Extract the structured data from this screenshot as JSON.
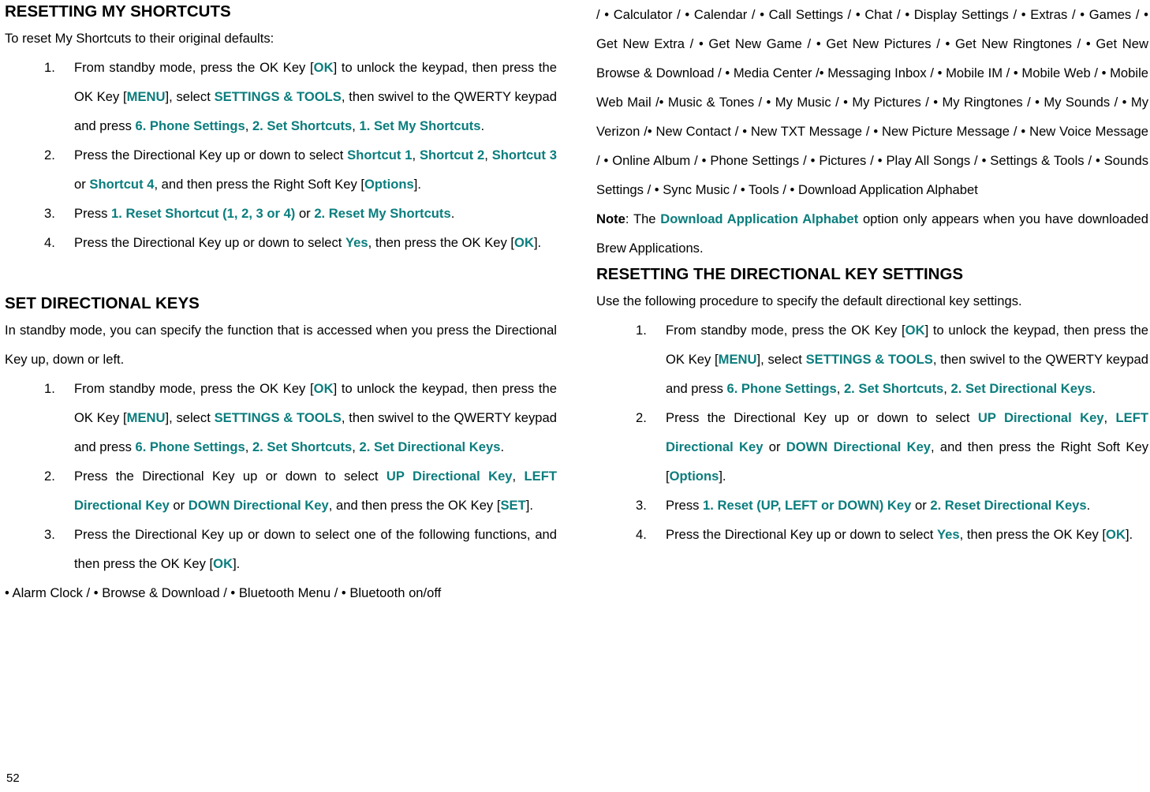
{
  "page": {
    "number": "52",
    "accent_color": "#0b7d7d",
    "text_color": "#000000",
    "background_color": "#ffffff"
  },
  "left_column": {
    "section1": {
      "heading": "RESETTING MY SHORTCUTS",
      "intro": "To reset My Shortcuts to their original defaults:",
      "steps": [
        {
          "number": "1.",
          "parts": [
            {
              "text": "From standby mode, press the OK Key [",
              "style": "plain"
            },
            {
              "text": "OK",
              "style": "accent"
            },
            {
              "text": "] to unlock the keypad, then press the OK Key [",
              "style": "plain"
            },
            {
              "text": "MENU",
              "style": "accent"
            },
            {
              "text": "], select ",
              "style": "plain"
            },
            {
              "text": "SETTINGS & TOOLS",
              "style": "accent"
            },
            {
              "text": ", then swivel to the QWERTY keypad and press ",
              "style": "plain"
            },
            {
              "text": "6. Phone Settings",
              "style": "accent"
            },
            {
              "text": ", ",
              "style": "plain"
            },
            {
              "text": "2. Set Shortcuts",
              "style": "accent"
            },
            {
              "text": ", ",
              "style": "plain"
            },
            {
              "text": "1. Set My Shortcuts",
              "style": "accent"
            },
            {
              "text": ".",
              "style": "plain"
            }
          ]
        },
        {
          "number": "2.",
          "parts": [
            {
              "text": "Press the Directional Key up or down to select ",
              "style": "plain"
            },
            {
              "text": "Shortcut 1",
              "style": "accent"
            },
            {
              "text": ", ",
              "style": "plain"
            },
            {
              "text": "Shortcut 2",
              "style": "accent"
            },
            {
              "text": ", ",
              "style": "plain"
            },
            {
              "text": "Shortcut 3",
              "style": "accent"
            },
            {
              "text": " or ",
              "style": "plain"
            },
            {
              "text": "Shortcut 4",
              "style": "accent"
            },
            {
              "text": ", and then press the Right Soft Key [",
              "style": "plain"
            },
            {
              "text": "Options",
              "style": "accent"
            },
            {
              "text": "].",
              "style": "plain"
            }
          ]
        },
        {
          "number": "3.",
          "parts": [
            {
              "text": "Press ",
              "style": "plain"
            },
            {
              "text": "1. Reset Shortcut (1, 2, 3 or 4)",
              "style": "accent"
            },
            {
              "text": " or ",
              "style": "plain"
            },
            {
              "text": "2. Reset My Shortcuts",
              "style": "accent"
            },
            {
              "text": ".",
              "style": "plain"
            }
          ]
        },
        {
          "number": "4.",
          "parts": [
            {
              "text": "Press the Directional Key up or down to select ",
              "style": "plain"
            },
            {
              "text": "Yes",
              "style": "accent"
            },
            {
              "text": ", then press the OK Key [",
              "style": "plain"
            },
            {
              "text": "OK",
              "style": "accent"
            },
            {
              "text": "].",
              "style": "plain"
            }
          ]
        }
      ]
    },
    "section2": {
      "heading": "SET DIRECTIONAL KEYS",
      "intro": "In standby mode, you can specify the function that is accessed when you press the Directional Key up, down or left.",
      "steps": [
        {
          "number": "1.",
          "parts": [
            {
              "text": "From standby mode, press the OK Key [",
              "style": "plain"
            },
            {
              "text": "OK",
              "style": "accent"
            },
            {
              "text": "] to unlock the keypad, then press the OK Key [",
              "style": "plain"
            },
            {
              "text": "MENU",
              "style": "accent"
            },
            {
              "text": "], select ",
              "style": "plain"
            },
            {
              "text": "SETTINGS & TOOLS",
              "style": "accent"
            },
            {
              "text": ", then swivel to the QWERTY keypad and press ",
              "style": "plain"
            },
            {
              "text": "6. Phone Settings",
              "style": "accent"
            },
            {
              "text": ", ",
              "style": "plain"
            },
            {
              "text": "2. Set Shortcuts",
              "style": "accent"
            },
            {
              "text": ", ",
              "style": "plain"
            },
            {
              "text": "2. Set Directional Keys",
              "style": "accent"
            },
            {
              "text": ".",
              "style": "plain"
            }
          ]
        },
        {
          "number": "2.",
          "parts": [
            {
              "text": "Press the Directional Key up or down to select ",
              "style": "plain"
            },
            {
              "text": "UP Directional Key",
              "style": "accent"
            },
            {
              "text": ", ",
              "style": "plain"
            },
            {
              "text": "LEFT Directional Key",
              "style": "accent"
            },
            {
              "text": " or ",
              "style": "plain"
            },
            {
              "text": "DOWN Directional Key",
              "style": "accent"
            },
            {
              "text": ", and then press the OK Key [",
              "style": "plain"
            },
            {
              "text": "SET",
              "style": "accent"
            },
            {
              "text": "].",
              "style": "plain"
            }
          ]
        },
        {
          "number": "3.",
          "parts": [
            {
              "text": "Press the Directional Key up or down to select one of the following functions, and then press the OK Key [",
              "style": "plain"
            },
            {
              "text": "OK",
              "style": "accent"
            },
            {
              "text": "].",
              "style": "plain"
            }
          ]
        }
      ],
      "function_list_part1": "• Alarm Clock / • Browse & Download / • Bluetooth Menu / • Bluetooth on/off"
    }
  },
  "right_column": {
    "function_list_part2": "/ • Calculator / • Calendar / • Call Settings / • Chat / • Display Settings / • Extras / • Games / • Get New Extra / • Get New Game / • Get New Pictures / • Get New Ringtones / • Get New Browse & Download / • Media Center /• Messaging Inbox / • Mobile IM / • Mobile Web / • Mobile Web Mail /• Music & Tones / • My Music / • My Pictures / • My Ringtones / • My Sounds / • My Verizon /• New Contact / • New TXT Message / • New Picture Message / • New Voice Message / • Online Album / • Phone Settings / • Pictures / • Play All Songs / • Settings & Tools / • Sounds Settings / • Sync Music / • Tools / • Download Application Alphabet",
    "note": {
      "label": "Note",
      "parts": [
        {
          "text": "Note",
          "style": "bold"
        },
        {
          "text": ": The ",
          "style": "plain"
        },
        {
          "text": "Download Application Alphabet",
          "style": "accent"
        },
        {
          "text": " option only appears when you have downloaded Brew Applications.",
          "style": "plain"
        }
      ]
    },
    "section3": {
      "heading": "RESETTING THE DIRECTIONAL KEY SETTINGS",
      "intro": "Use the following procedure to specify the default directional key settings.",
      "steps": [
        {
          "number": "1.",
          "parts": [
            {
              "text": "From standby mode, press the OK Key [",
              "style": "plain"
            },
            {
              "text": "OK",
              "style": "accent"
            },
            {
              "text": "] to unlock the keypad, then press the OK Key [",
              "style": "plain"
            },
            {
              "text": "MENU",
              "style": "accent"
            },
            {
              "text": "], select ",
              "style": "plain"
            },
            {
              "text": "SETTINGS & TOOLS",
              "style": "accent"
            },
            {
              "text": ", then swivel to the QWERTY keypad and press ",
              "style": "plain"
            },
            {
              "text": "6. Phone Settings",
              "style": "accent"
            },
            {
              "text": ", ",
              "style": "plain"
            },
            {
              "text": "2. Set Shortcuts",
              "style": "accent"
            },
            {
              "text": ", ",
              "style": "plain"
            },
            {
              "text": "2. Set Directional Keys",
              "style": "accent"
            },
            {
              "text": ".",
              "style": "plain"
            }
          ]
        },
        {
          "number": "2.",
          "parts": [
            {
              "text": "Press the Directional Key up or down to select ",
              "style": "plain"
            },
            {
              "text": "UP Directional Key",
              "style": "accent"
            },
            {
              "text": ", ",
              "style": "plain"
            },
            {
              "text": "LEFT Directional Key",
              "style": "accent"
            },
            {
              "text": " or ",
              "style": "plain"
            },
            {
              "text": "DOWN Directional Key",
              "style": "accent"
            },
            {
              "text": ", and then press the Right Soft Key [",
              "style": "plain"
            },
            {
              "text": "Options",
              "style": "accent"
            },
            {
              "text": "].",
              "style": "plain"
            }
          ]
        },
        {
          "number": "3.",
          "parts": [
            {
              "text": "Press ",
              "style": "plain"
            },
            {
              "text": "1. Reset (UP, LEFT or DOWN) Key",
              "style": "accent"
            },
            {
              "text": " or ",
              "style": "plain"
            },
            {
              "text": "2. Reset Directional Keys",
              "style": "accent"
            },
            {
              "text": ".",
              "style": "plain"
            }
          ]
        },
        {
          "number": "4.",
          "parts": [
            {
              "text": "Press the Directional Key up or down to select ",
              "style": "plain"
            },
            {
              "text": "Yes",
              "style": "accent"
            },
            {
              "text": ", then press the OK Key [",
              "style": "plain"
            },
            {
              "text": "OK",
              "style": "accent"
            },
            {
              "text": "].",
              "style": "plain"
            }
          ]
        }
      ]
    }
  }
}
